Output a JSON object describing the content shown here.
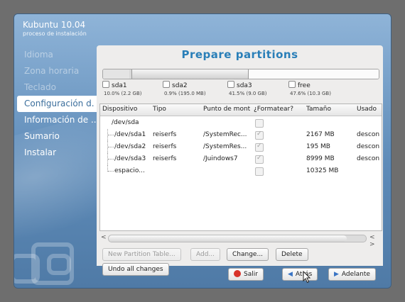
{
  "app": {
    "title": "Kubuntu 10.04",
    "subtitle": "proceso de instalación"
  },
  "sidebar": {
    "steps": [
      {
        "label": "Idioma",
        "state": "past"
      },
      {
        "label": "Zona horaria",
        "state": "past"
      },
      {
        "label": "Teclado",
        "state": "past"
      },
      {
        "label": "Configuración d.",
        "state": "active"
      },
      {
        "label": "Información de ...",
        "state": "future"
      },
      {
        "label": "Sumario",
        "state": "future"
      },
      {
        "label": "Instalar",
        "state": "future"
      }
    ]
  },
  "page": {
    "title": "Prepare partitions"
  },
  "partition_bar": {
    "legend": [
      {
        "name": "sda1",
        "size": "10.0% (2.2 GB)"
      },
      {
        "name": "sda2",
        "size": "0.9% (195.0 MB)"
      },
      {
        "name": "sda3",
        "size": "41.5% (9.0 GB)"
      },
      {
        "name": "free",
        "size": "47.6% (10.3 GB)"
      }
    ]
  },
  "table": {
    "columns": [
      "Dispositivo",
      "Tipo",
      "Punto de mont",
      "¿Formatear?",
      "Tamaño",
      "Usado"
    ],
    "rows": [
      {
        "device": "/dev/sda",
        "type": "",
        "mount": "",
        "format": false,
        "size": "",
        "used": ""
      },
      {
        "device": "/dev/sda1",
        "type": "reiserfs",
        "mount": "/SystemRec...",
        "format": true,
        "size": "2167 MB",
        "used": "descon"
      },
      {
        "device": "/dev/sda2",
        "type": "reiserfs",
        "mount": "/SystemRes...",
        "format": true,
        "size": "195 MB",
        "used": "descon"
      },
      {
        "device": "/dev/sda3",
        "type": "reiserfs",
        "mount": "/Juindows7",
        "format": true,
        "size": "8999 MB",
        "used": "descon"
      },
      {
        "device": "espacio...",
        "type": "",
        "mount": "",
        "format": false,
        "size": "10325 MB",
        "used": ""
      }
    ]
  },
  "scrollbar": {
    "left": "<",
    "right": "< >"
  },
  "actions": {
    "new_partition_table": "New Partition Table...",
    "add": "Add...",
    "change": "Change...",
    "delete": "Delete",
    "undo": "Undo all changes"
  },
  "footer": {
    "quit": "Salir",
    "back": "Atrás",
    "next": "Adelante"
  },
  "colors": {
    "accent": "#2a7fb8",
    "quit_icon": "#d8332a",
    "nav_icon": "#3a74c4"
  }
}
